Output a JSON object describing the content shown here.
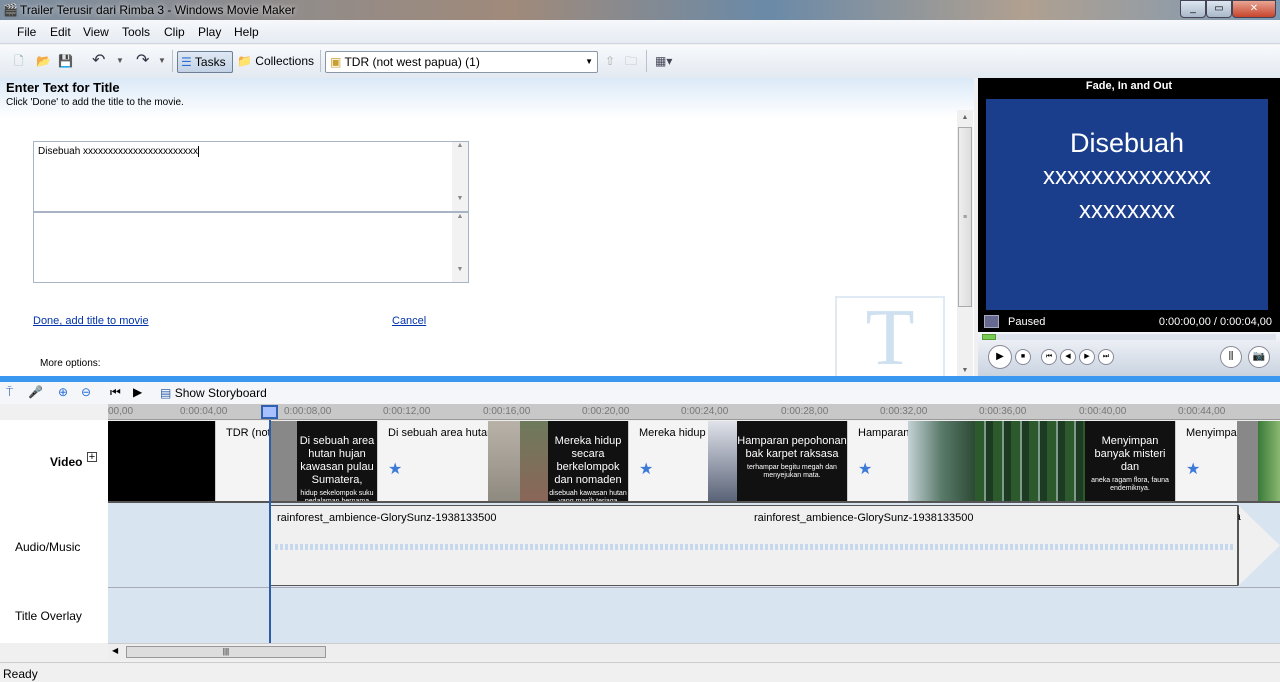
{
  "window": {
    "title": "Trailer Terusir dari Rimba 3 - Windows Movie Maker",
    "controls": [
      "_",
      "▭",
      "✕"
    ]
  },
  "menu": [
    "File",
    "Edit",
    "View",
    "Tools",
    "Clip",
    "Play",
    "Help"
  ],
  "toolbar": {
    "tasks": "Tasks",
    "collections": "Collections",
    "collection_selected": "TDR (not west papua) (1)"
  },
  "task_pane": {
    "heading": "Enter Text for Title",
    "instruction": "Click 'Done' to add the title to the movie.",
    "title_text": "Disebuah xxxxxxxxxxxxxxxxxxxxxxx",
    "second_text": "",
    "done_link": "Done, add title to movie",
    "cancel_link": "Cancel",
    "more_options": "More options:"
  },
  "preview": {
    "header": "Fade, In and Out",
    "screen_lines": [
      "Disebuah",
      "xxxxxxxxxxxxxx",
      "xxxxxxxx"
    ],
    "status": "Paused",
    "time": "0:00:00,00 / 0:00:04,00",
    "progress_fraction": 0
  },
  "timeline": {
    "show_storyboard": "Show Storyboard",
    "ruler": [
      "00,00",
      "0:00:04,00",
      "0:00:08,00",
      "0:00:12,00",
      "0:00:16,00",
      "0:00:20,00",
      "0:00:24,00",
      "0:00:28,00",
      "0:00:32,00",
      "0:00:36,00",
      "0:00:40,00",
      "0:00:44,00"
    ],
    "tracks": {
      "video": "Video",
      "audio": "Audio/Music",
      "title_overlay": "Title Overlay"
    },
    "video_clips": [
      {
        "title": "TDR (not w..."
      },
      {
        "text": "Di sebuah area hutan hujan kawasan pulau Sumatera,",
        "small": "hidup sekelompok suku pedalaman bernama suku BORURU"
      },
      {
        "title": "Di sebuah area  hutan huj..."
      },
      {
        "text": "Mereka hidup secara berkelompok dan nomaden",
        "small": "disebuah kawasan hutan yang masih terjaga kelestariannya."
      },
      {
        "title": "Mereka hidup sec..."
      },
      {
        "text": "Hamparan pepohonan bak karpet raksasa",
        "small": "terhampar begitu megah dan menyejukan mata."
      },
      {
        "title": "Hamparan pe..."
      },
      {
        "text": "Menyimpan banyak misteri dan",
        "small": "aneka ragam flora, fauna endemiknya."
      },
      {
        "title": "Menyimpan ba..."
      }
    ],
    "audio_clips": [
      "rainforest_ambience-GlorySunz-1938133500",
      "rainforest_ambience-GlorySunz-1938133500",
      "ra"
    ]
  },
  "statusbar": "Ready"
}
